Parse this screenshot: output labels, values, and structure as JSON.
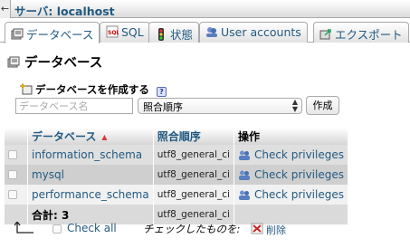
{
  "topbar": {
    "server_label": "サーバ: localhost"
  },
  "tabs": [
    {
      "label": "データベース",
      "icon": "database-icon",
      "active": true
    },
    {
      "label": "SQL",
      "icon": "sql-icon",
      "active": false
    },
    {
      "label": "状態",
      "icon": "status-icon",
      "active": false
    },
    {
      "label": "User accounts",
      "icon": "user-accounts-icon",
      "active": false
    },
    {
      "label": "エクスポート",
      "icon": "export-icon",
      "active": false
    }
  ],
  "page": {
    "title": "データベース"
  },
  "create": {
    "label": "データベースを作成する",
    "name_placeholder": "データベース名",
    "collation_value": "照合順序",
    "button": "作成"
  },
  "table": {
    "headers": {
      "database": "データベース",
      "collation": "照合順序",
      "action": "操作"
    },
    "rows": [
      {
        "name": "information_schema",
        "collation": "utf8_general_ci",
        "action": "Check privileges"
      },
      {
        "name": "mysql",
        "collation": "utf8_general_ci",
        "action": "Check privileges"
      },
      {
        "name": "performance_schema",
        "collation": "utf8_general_ci",
        "action": "Check privileges"
      }
    ],
    "total": {
      "label": "合計: 3",
      "collation": "utf8_general_ci"
    }
  },
  "bottom": {
    "check_all": "Check all",
    "with_selected": "チェックしたものを:",
    "delete": "削除"
  },
  "colors": {
    "link": "#235a81",
    "sort_arrow": "#d83a3a"
  }
}
